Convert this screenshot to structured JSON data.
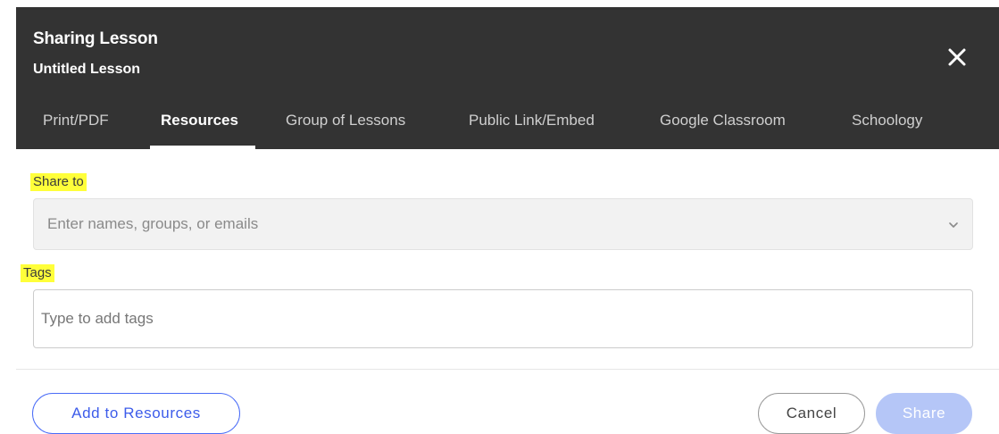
{
  "dialog": {
    "title": "Sharing Lesson",
    "subtitle": "Untitled Lesson",
    "close_icon": "close-icon"
  },
  "tabs": [
    {
      "label": "Print/PDF",
      "active": false
    },
    {
      "label": "Resources",
      "active": true
    },
    {
      "label": "Group of Lessons",
      "active": false
    },
    {
      "label": "Public Link/Embed",
      "active": false
    },
    {
      "label": "Google Classroom",
      "active": false
    },
    {
      "label": "Schoology",
      "active": false
    }
  ],
  "form": {
    "share_to": {
      "label": "Share to",
      "placeholder": "Enter names, groups, or emails",
      "value": "",
      "icon": "chevron-down-icon"
    },
    "tags": {
      "label": "Tags",
      "placeholder": "Type to add tags",
      "value": ""
    }
  },
  "footer": {
    "add_label": "Add to Resources",
    "cancel_label": "Cancel",
    "share_label": "Share"
  },
  "colors": {
    "header_bg": "#333333",
    "highlight": "#ffff3a",
    "accent": "#4a6cf7",
    "share_disabled": "#b5c6f7"
  }
}
